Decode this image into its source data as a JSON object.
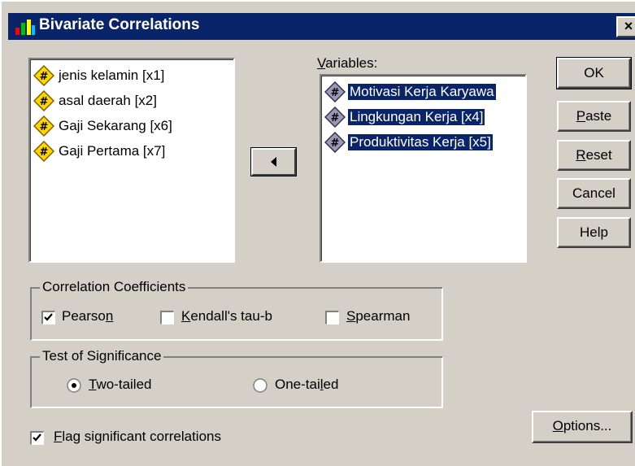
{
  "window": {
    "title": "Bivariate Correlations",
    "close_glyph": "×"
  },
  "source_list": {
    "items": [
      {
        "label": "jenis kelamin [x1]",
        "icon": "scale-variable-icon"
      },
      {
        "label": "asal daerah [x2]",
        "icon": "scale-variable-icon"
      },
      {
        "label": "Gaji Sekarang [x6]",
        "icon": "scale-variable-icon"
      },
      {
        "label": "Gaji Pertama [x7]",
        "icon": "scale-variable-icon"
      }
    ]
  },
  "move_button": {
    "icon": "arrow-left-icon"
  },
  "variables": {
    "label_prefix": "V",
    "label_rest": "ariables:",
    "items": [
      {
        "label": "Motivasi Kerja Karyawa",
        "selected": true,
        "icon": "scale-variable-icon"
      },
      {
        "label": "Lingkungan Kerja [x4]",
        "selected": true,
        "icon": "scale-variable-icon"
      },
      {
        "label": "Produktivitas Kerja [x5]",
        "selected": true,
        "icon": "scale-variable-icon"
      }
    ]
  },
  "buttons": {
    "ok": "OK",
    "paste_u": "P",
    "paste_rest": "aste",
    "reset_u": "R",
    "reset_rest": "eset",
    "cancel": "Cancel",
    "help": "Help",
    "options_u": "O",
    "options_rest": "ptions..."
  },
  "correlation": {
    "title": "Correlation Coefficients",
    "pearson_a": "Pearso",
    "pearson_u": "n",
    "pearson_checked": true,
    "kendall_u": "K",
    "kendall_rest": "endall's tau-b",
    "kendall_checked": false,
    "spearman_u": "S",
    "spearman_rest": "pearman",
    "spearman_checked": false
  },
  "significance": {
    "title": "Test of Significance",
    "two_u": "T",
    "two_rest": "wo-tailed",
    "two_selected": true,
    "one_a": "One-tai",
    "one_u": "l",
    "one_rest": "ed",
    "one_selected": false
  },
  "flag": {
    "u": "F",
    "rest": "lag significant correlations",
    "checked": true
  },
  "colors": {
    "face": "#d4d0c8",
    "titlebar": "#0a246a",
    "selection": "#0a246a"
  }
}
